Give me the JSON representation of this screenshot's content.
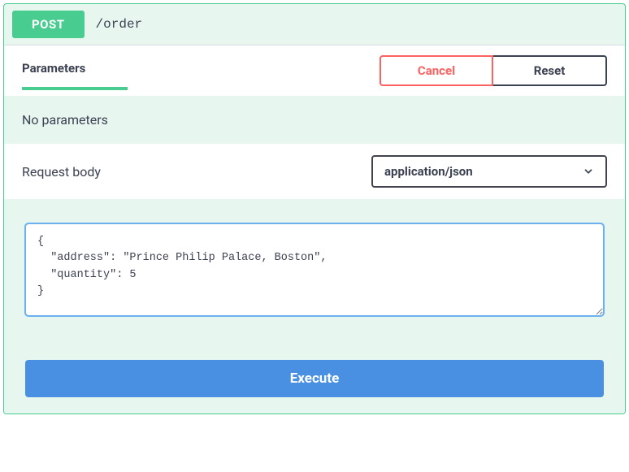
{
  "header": {
    "method": "POST",
    "path": "/order"
  },
  "tabs": {
    "parameters_label": "Parameters"
  },
  "actions": {
    "cancel_label": "Cancel",
    "reset_label": "Reset",
    "execute_label": "Execute"
  },
  "sections": {
    "no_parameters_text": "No parameters",
    "request_body_label": "Request body"
  },
  "content_type": {
    "selected": "application/json"
  },
  "request_body_value": "{\n  \"address\": \"Prince Philip Palace, Boston\",\n  \"quantity\": 5\n}"
}
